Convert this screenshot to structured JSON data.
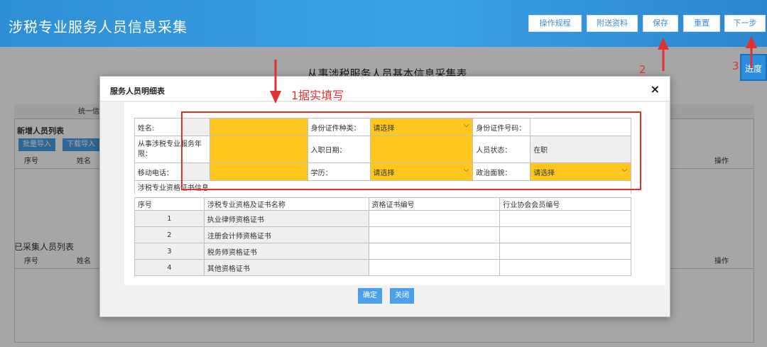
{
  "header": {
    "title": "涉税专业服务人员信息采集",
    "buttons": [
      "操作规程",
      "附送资料",
      "保存",
      "重置",
      "下一步"
    ],
    "progress_label": "进度"
  },
  "page": {
    "title": "从事涉税服务人员基本信息采集表",
    "unified_label": "统一信",
    "new_list_title": "新增人员列表",
    "batch_import": "批量导入",
    "download_import": "下载导入",
    "collected_list_title": "已采集人员列表",
    "col_no": "序号",
    "col_name": "姓名",
    "col_op": "操作"
  },
  "modal": {
    "title": "服务人员明细表",
    "close_icon": "×",
    "labels": {
      "name": "姓名:",
      "id_type": "身份证件种类：",
      "id_no": "身份证件号码：",
      "years": "从事涉税专业服务年限：",
      "entry_date": "入职日期：",
      "status": "人员状态：",
      "phone": "移动电话：",
      "education": "学历：",
      "political": "政治面貌：",
      "cert_section": "涉税专业资格证书信息"
    },
    "values": {
      "id_type": "请选择",
      "status": "在职",
      "education": "请选择",
      "political": "请选择"
    },
    "cert_headers": [
      "序号",
      "涉税专业资格及证书名称",
      "资格证书编号",
      "行业协会会员编号"
    ],
    "cert_rows": [
      {
        "no": "1",
        "name": "执业律师资格证书"
      },
      {
        "no": "2",
        "name": "注册会计师资格证书"
      },
      {
        "no": "3",
        "name": "税务师资格证书"
      },
      {
        "no": "4",
        "name": "其他资格证书"
      }
    ],
    "confirm": "确定",
    "close": "关闭"
  },
  "annotations": {
    "step1": "1据实填写",
    "step2": "2",
    "step3": "3"
  },
  "colors": {
    "header_blue": "#2f8fd6",
    "field_yellow": "#ffc71d",
    "annotation_red": "#e03030"
  }
}
